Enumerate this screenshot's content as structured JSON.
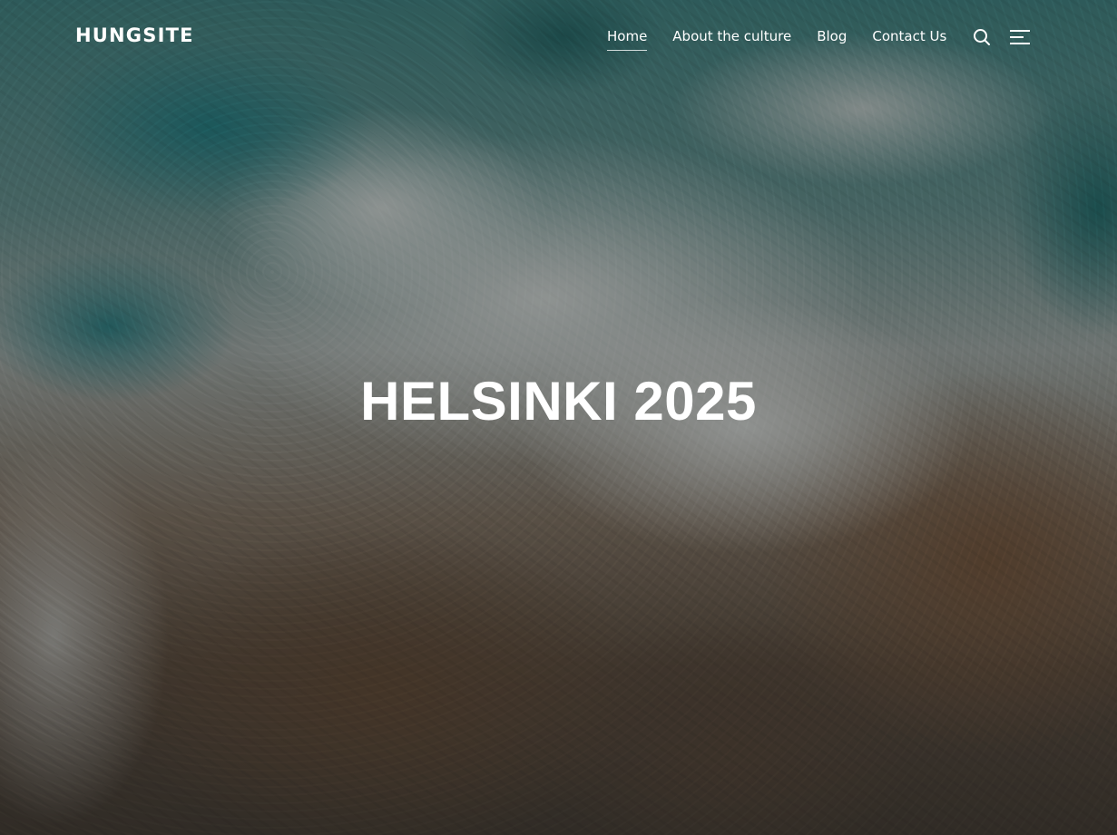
{
  "site": {
    "logo": "HUNGSITE"
  },
  "nav": {
    "items": [
      {
        "label": "Home",
        "active": true
      },
      {
        "label": "About the culture",
        "active": false
      },
      {
        "label": "Blog",
        "active": false
      },
      {
        "label": "Contact Us",
        "active": false
      }
    ],
    "search_icon": "search-icon",
    "menu_icon": "menu-icon"
  },
  "hero": {
    "title": "HELSINKI 2025",
    "background": "aerial photo of ocean waves crashing on rocky shore"
  },
  "colors": {
    "text": "#ffffff",
    "overlay": "#141414"
  }
}
